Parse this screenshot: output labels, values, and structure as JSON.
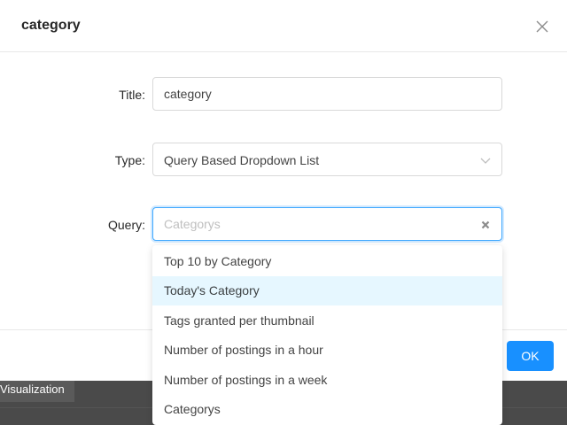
{
  "background": {
    "tab_label": "Visualization"
  },
  "dialog": {
    "title": "category",
    "close_icon": "close-icon",
    "ok_label": "OK",
    "accent_color": "#1890ff"
  },
  "form": {
    "title_label": "Title:",
    "title_value": "category",
    "type_label": "Type:",
    "type_value": "Query Based Dropdown List",
    "type_icon": "chevron-down-icon",
    "query_label": "Query:",
    "query_placeholder": "Categorys",
    "query_clear_icon": "clear-icon"
  },
  "dropdown": {
    "options": [
      {
        "label": "Top 10 by Category",
        "highlighted": false
      },
      {
        "label": "Today's Category",
        "highlighted": true
      },
      {
        "label": "Tags granted per thumbnail",
        "highlighted": false
      },
      {
        "label": "Number of postings in a hour",
        "highlighted": false
      },
      {
        "label": "Number of postings in a week",
        "highlighted": false
      },
      {
        "label": "Categorys",
        "highlighted": false
      }
    ]
  }
}
